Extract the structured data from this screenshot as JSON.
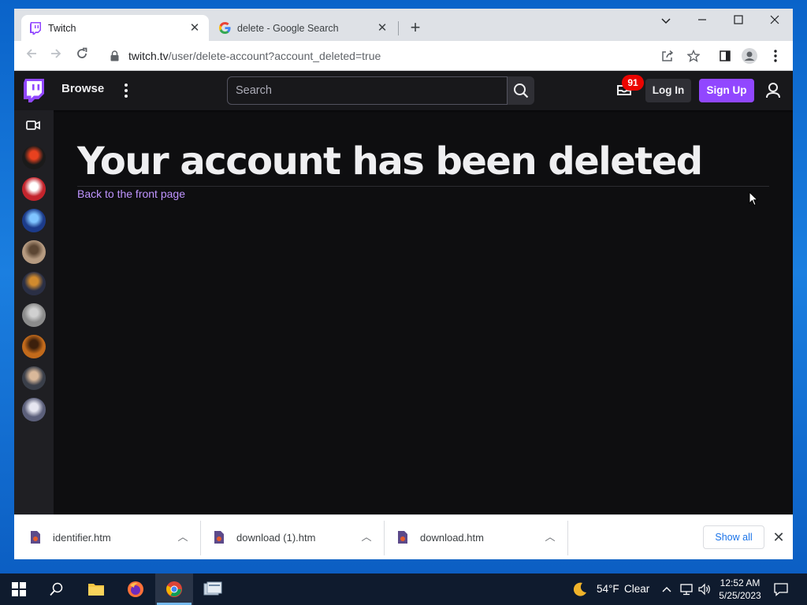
{
  "browser": {
    "tabs": [
      {
        "title": "Twitch",
        "active": true
      },
      {
        "title": "delete - Google Search",
        "active": false
      }
    ],
    "address_host": "twitch.tv",
    "address_path": "/user/delete-account?account_deleted=true"
  },
  "twitch": {
    "nav": {
      "browse_label": "Browse",
      "search_placeholder": "Search",
      "notification_count": "91",
      "login_label": "Log In",
      "signup_label": "Sign Up"
    },
    "sidebar_avatars": [
      {
        "name": "channel-1g",
        "color": "#1a1a1a",
        "accent": "#e8411f"
      },
      {
        "name": "channel-red-hex",
        "color": "#c4242c",
        "accent": "#ffffff"
      },
      {
        "name": "channel-blue-hair",
        "color": "#1c3b8a",
        "accent": "#7fc4ff"
      },
      {
        "name": "channel-man-glasses",
        "color": "#b59a80",
        "accent": "#5c4633"
      },
      {
        "name": "channel-dark-bolt",
        "color": "#2a2f45",
        "accent": "#d08a2e"
      },
      {
        "name": "channel-grey-art",
        "color": "#8b8b8b",
        "accent": "#d0d0d0"
      },
      {
        "name": "channel-orange-face",
        "color": "#c26a1b",
        "accent": "#3b1f0c"
      },
      {
        "name": "channel-man-beard",
        "color": "#3a3f4a",
        "accent": "#d9b89a"
      },
      {
        "name": "channel-anime-pair",
        "color": "#5b5f7a",
        "accent": "#e6e6f0"
      }
    ],
    "headline": "Your account has been deleted",
    "back_link": "Back to the front page",
    "colors": {
      "purple": "#9147ff",
      "link": "#bf94ff",
      "background": "#0e0e10"
    }
  },
  "downloads": {
    "items": [
      {
        "filename": "identifier.htm"
      },
      {
        "filename": "download (1).htm"
      },
      {
        "filename": "download.htm"
      }
    ],
    "show_all_label": "Show all"
  },
  "taskbar": {
    "weather_temp": "54°F",
    "weather_cond": "Clear",
    "time": "12:52 AM",
    "date": "5/25/2023"
  }
}
